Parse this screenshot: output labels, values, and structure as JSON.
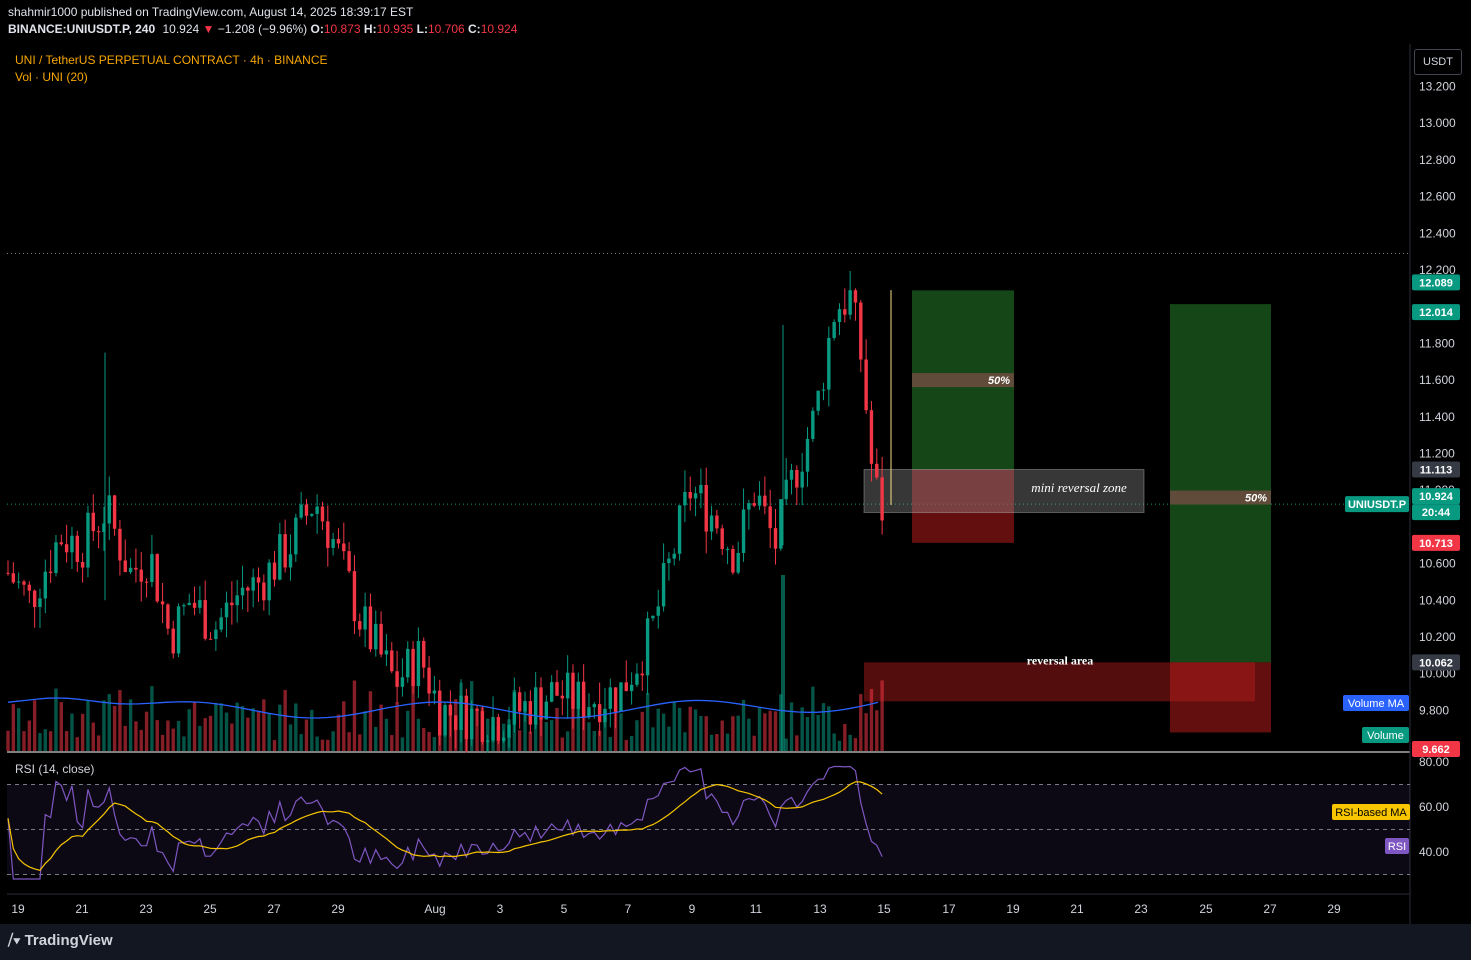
{
  "header": {
    "line1": "shahmir1000 published on TradingView.com, August 14, 2025 18:39:17 EST",
    "symbol": "BINANCE:UNIUSDT.P, 240",
    "price": "10.924",
    "change": "−1.208 (−9.96%)",
    "o_label": "O:",
    "o": "10.873",
    "h_label": "H:",
    "h": "10.935",
    "l_label": "L:",
    "l": "10.706",
    "c_label": "C:",
    "c": "10.924"
  },
  "legend": {
    "main": "UNI / TetherUS PERPETUAL CONTRACT · 4h · BINANCE",
    "volume": "Vol · UNI (20)",
    "rsi": "RSI (14, close)"
  },
  "currency_button": "USDT",
  "brand": "TradingView",
  "chart_data": {
    "type": "candlestick",
    "price_axis": {
      "ticks": [
        "13.200",
        "13.000",
        "12.800",
        "12.600",
        "12.400",
        "12.200",
        "11.800",
        "11.600",
        "11.400",
        "11.200",
        "11.000",
        "10.600",
        "10.400",
        "10.200",
        "10.000",
        "9.800"
      ],
      "range": [
        9.66,
        13.3
      ]
    },
    "price_labels": [
      {
        "text": "12.089",
        "value": 12.089,
        "color": "#089981"
      },
      {
        "text": "12.014",
        "value": 12.014,
        "color": "#089981"
      },
      {
        "text": "11.113",
        "value": 11.113,
        "color": "#363a45"
      },
      {
        "text": "UNIUSDT.P",
        "value": 10.924,
        "color": "#089981"
      },
      {
        "text": "10.924",
        "value": 10.924,
        "color": "#089981"
      },
      {
        "text": "20:44",
        "value": 10.924,
        "color": "#089981"
      },
      {
        "text": "10.713",
        "value": 10.713,
        "color": "#f23645"
      },
      {
        "text": "10.062",
        "value": 10.062,
        "color": "#363a45"
      },
      {
        "text": "9.662",
        "value": 9.662,
        "color": "#f23645"
      }
    ],
    "indicator_labels": [
      {
        "text": "Volume MA",
        "color": "#2962ff"
      },
      {
        "text": "Volume",
        "color": "#089981"
      },
      {
        "text": "RSI-based MA",
        "color": "#f7c600"
      },
      {
        "text": "RSI",
        "color": "#7e57c2"
      }
    ],
    "rsi_axis": {
      "ticks": [
        "80.00",
        "60.00",
        "40.00"
      ],
      "range": [
        25,
        82
      ],
      "bands": [
        70,
        50,
        30
      ]
    },
    "x_ticks": [
      "19",
      "21",
      "23",
      "25",
      "27",
      "29",
      "Aug",
      "3",
      "5",
      "7",
      "9",
      "11",
      "13",
      "15",
      "17",
      "19",
      "21",
      "23",
      "25",
      "27",
      "29"
    ],
    "annotations": [
      {
        "text": "mini reversal zone"
      },
      {
        "text": "reversal area"
      },
      {
        "text": "50%"
      },
      {
        "text": "50%"
      }
    ],
    "positions": [
      {
        "name": "position-1",
        "entry": 11.113,
        "target": 12.089,
        "stop": 10.713,
        "mid": 11.6
      },
      {
        "name": "position-2",
        "entry": 10.062,
        "target": 12.014,
        "stop": 9.68,
        "mid": 10.96
      }
    ],
    "zones": [
      {
        "name": "mini-reversal-zone",
        "top": 11.113,
        "bottom": 10.9
      },
      {
        "name": "reversal-area",
        "top": 10.062,
        "bottom": 9.86
      }
    ],
    "last_price": 10.924,
    "recent_high": 12.29
  }
}
